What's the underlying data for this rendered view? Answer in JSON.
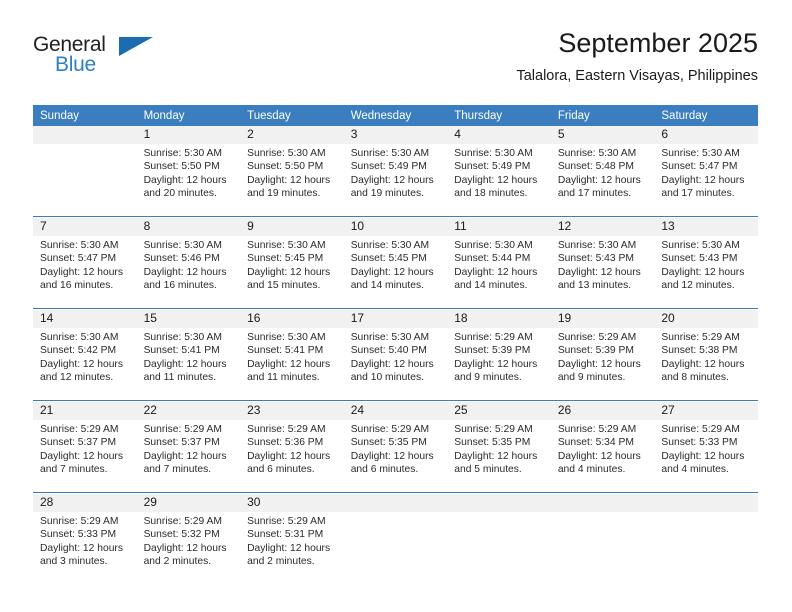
{
  "brand": {
    "name_part1": "General",
    "name_part2": "Blue",
    "triangle_icon": "triangle-icon",
    "accent_color": "#2e80c4"
  },
  "header": {
    "title": "September 2025",
    "subtitle": "Talalora, Eastern Visayas, Philippines"
  },
  "theme": {
    "header_blue": "#3a7ebf",
    "daynum_background": "#f1f1f1",
    "separator_blue": "#3a7ebf"
  },
  "weekday_headers": [
    "Sunday",
    "Monday",
    "Tuesday",
    "Wednesday",
    "Thursday",
    "Friday",
    "Saturday"
  ],
  "weeks": [
    [
      {
        "day": "",
        "sunrise": "",
        "sunset": "",
        "daylight_line1": "",
        "daylight_line2": ""
      },
      {
        "day": "1",
        "sunrise": "Sunrise: 5:30 AM",
        "sunset": "Sunset: 5:50 PM",
        "daylight_line1": "Daylight: 12 hours",
        "daylight_line2": "and 20 minutes."
      },
      {
        "day": "2",
        "sunrise": "Sunrise: 5:30 AM",
        "sunset": "Sunset: 5:50 PM",
        "daylight_line1": "Daylight: 12 hours",
        "daylight_line2": "and 19 minutes."
      },
      {
        "day": "3",
        "sunrise": "Sunrise: 5:30 AM",
        "sunset": "Sunset: 5:49 PM",
        "daylight_line1": "Daylight: 12 hours",
        "daylight_line2": "and 19 minutes."
      },
      {
        "day": "4",
        "sunrise": "Sunrise: 5:30 AM",
        "sunset": "Sunset: 5:49 PM",
        "daylight_line1": "Daylight: 12 hours",
        "daylight_line2": "and 18 minutes."
      },
      {
        "day": "5",
        "sunrise": "Sunrise: 5:30 AM",
        "sunset": "Sunset: 5:48 PM",
        "daylight_line1": "Daylight: 12 hours",
        "daylight_line2": "and 17 minutes."
      },
      {
        "day": "6",
        "sunrise": "Sunrise: 5:30 AM",
        "sunset": "Sunset: 5:47 PM",
        "daylight_line1": "Daylight: 12 hours",
        "daylight_line2": "and 17 minutes."
      }
    ],
    [
      {
        "day": "7",
        "sunrise": "Sunrise: 5:30 AM",
        "sunset": "Sunset: 5:47 PM",
        "daylight_line1": "Daylight: 12 hours",
        "daylight_line2": "and 16 minutes."
      },
      {
        "day": "8",
        "sunrise": "Sunrise: 5:30 AM",
        "sunset": "Sunset: 5:46 PM",
        "daylight_line1": "Daylight: 12 hours",
        "daylight_line2": "and 16 minutes."
      },
      {
        "day": "9",
        "sunrise": "Sunrise: 5:30 AM",
        "sunset": "Sunset: 5:45 PM",
        "daylight_line1": "Daylight: 12 hours",
        "daylight_line2": "and 15 minutes."
      },
      {
        "day": "10",
        "sunrise": "Sunrise: 5:30 AM",
        "sunset": "Sunset: 5:45 PM",
        "daylight_line1": "Daylight: 12 hours",
        "daylight_line2": "and 14 minutes."
      },
      {
        "day": "11",
        "sunrise": "Sunrise: 5:30 AM",
        "sunset": "Sunset: 5:44 PM",
        "daylight_line1": "Daylight: 12 hours",
        "daylight_line2": "and 14 minutes."
      },
      {
        "day": "12",
        "sunrise": "Sunrise: 5:30 AM",
        "sunset": "Sunset: 5:43 PM",
        "daylight_line1": "Daylight: 12 hours",
        "daylight_line2": "and 13 minutes."
      },
      {
        "day": "13",
        "sunrise": "Sunrise: 5:30 AM",
        "sunset": "Sunset: 5:43 PM",
        "daylight_line1": "Daylight: 12 hours",
        "daylight_line2": "and 12 minutes."
      }
    ],
    [
      {
        "day": "14",
        "sunrise": "Sunrise: 5:30 AM",
        "sunset": "Sunset: 5:42 PM",
        "daylight_line1": "Daylight: 12 hours",
        "daylight_line2": "and 12 minutes."
      },
      {
        "day": "15",
        "sunrise": "Sunrise: 5:30 AM",
        "sunset": "Sunset: 5:41 PM",
        "daylight_line1": "Daylight: 12 hours",
        "daylight_line2": "and 11 minutes."
      },
      {
        "day": "16",
        "sunrise": "Sunrise: 5:30 AM",
        "sunset": "Sunset: 5:41 PM",
        "daylight_line1": "Daylight: 12 hours",
        "daylight_line2": "and 11 minutes."
      },
      {
        "day": "17",
        "sunrise": "Sunrise: 5:30 AM",
        "sunset": "Sunset: 5:40 PM",
        "daylight_line1": "Daylight: 12 hours",
        "daylight_line2": "and 10 minutes."
      },
      {
        "day": "18",
        "sunrise": "Sunrise: 5:29 AM",
        "sunset": "Sunset: 5:39 PM",
        "daylight_line1": "Daylight: 12 hours",
        "daylight_line2": "and 9 minutes."
      },
      {
        "day": "19",
        "sunrise": "Sunrise: 5:29 AM",
        "sunset": "Sunset: 5:39 PM",
        "daylight_line1": "Daylight: 12 hours",
        "daylight_line2": "and 9 minutes."
      },
      {
        "day": "20",
        "sunrise": "Sunrise: 5:29 AM",
        "sunset": "Sunset: 5:38 PM",
        "daylight_line1": "Daylight: 12 hours",
        "daylight_line2": "and 8 minutes."
      }
    ],
    [
      {
        "day": "21",
        "sunrise": "Sunrise: 5:29 AM",
        "sunset": "Sunset: 5:37 PM",
        "daylight_line1": "Daylight: 12 hours",
        "daylight_line2": "and 7 minutes."
      },
      {
        "day": "22",
        "sunrise": "Sunrise: 5:29 AM",
        "sunset": "Sunset: 5:37 PM",
        "daylight_line1": "Daylight: 12 hours",
        "daylight_line2": "and 7 minutes."
      },
      {
        "day": "23",
        "sunrise": "Sunrise: 5:29 AM",
        "sunset": "Sunset: 5:36 PM",
        "daylight_line1": "Daylight: 12 hours",
        "daylight_line2": "and 6 minutes."
      },
      {
        "day": "24",
        "sunrise": "Sunrise: 5:29 AM",
        "sunset": "Sunset: 5:35 PM",
        "daylight_line1": "Daylight: 12 hours",
        "daylight_line2": "and 6 minutes."
      },
      {
        "day": "25",
        "sunrise": "Sunrise: 5:29 AM",
        "sunset": "Sunset: 5:35 PM",
        "daylight_line1": "Daylight: 12 hours",
        "daylight_line2": "and 5 minutes."
      },
      {
        "day": "26",
        "sunrise": "Sunrise: 5:29 AM",
        "sunset": "Sunset: 5:34 PM",
        "daylight_line1": "Daylight: 12 hours",
        "daylight_line2": "and 4 minutes."
      },
      {
        "day": "27",
        "sunrise": "Sunrise: 5:29 AM",
        "sunset": "Sunset: 5:33 PM",
        "daylight_line1": "Daylight: 12 hours",
        "daylight_line2": "and 4 minutes."
      }
    ],
    [
      {
        "day": "28",
        "sunrise": "Sunrise: 5:29 AM",
        "sunset": "Sunset: 5:33 PM",
        "daylight_line1": "Daylight: 12 hours",
        "daylight_line2": "and 3 minutes."
      },
      {
        "day": "29",
        "sunrise": "Sunrise: 5:29 AM",
        "sunset": "Sunset: 5:32 PM",
        "daylight_line1": "Daylight: 12 hours",
        "daylight_line2": "and 2 minutes."
      },
      {
        "day": "30",
        "sunrise": "Sunrise: 5:29 AM",
        "sunset": "Sunset: 5:31 PM",
        "daylight_line1": "Daylight: 12 hours",
        "daylight_line2": "and 2 minutes."
      },
      {
        "day": "",
        "sunrise": "",
        "sunset": "",
        "daylight_line1": "",
        "daylight_line2": ""
      },
      {
        "day": "",
        "sunrise": "",
        "sunset": "",
        "daylight_line1": "",
        "daylight_line2": ""
      },
      {
        "day": "",
        "sunrise": "",
        "sunset": "",
        "daylight_line1": "",
        "daylight_line2": ""
      },
      {
        "day": "",
        "sunrise": "",
        "sunset": "",
        "daylight_line1": "",
        "daylight_line2": ""
      }
    ]
  ]
}
